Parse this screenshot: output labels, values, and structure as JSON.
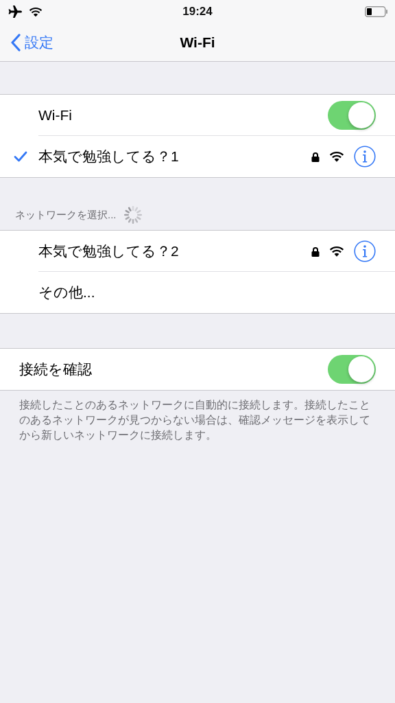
{
  "status_bar": {
    "time": "19:24"
  },
  "nav": {
    "back": "設定",
    "title": "Wi-Fi"
  },
  "groups": [
    {
      "rows": [
        {
          "kind": "toggle",
          "label": "Wi-Fi",
          "on": true,
          "indent": true
        },
        {
          "kind": "network",
          "label": "本気で勉強してる？1",
          "selected": true,
          "secured": true
        }
      ]
    },
    {
      "header": "ネットワークを選択...",
      "loading": true,
      "rows": [
        {
          "kind": "network",
          "label": "本気で勉強してる？2",
          "selected": false,
          "secured": true
        },
        {
          "kind": "other",
          "label": "その他..."
        }
      ]
    },
    {
      "rows": [
        {
          "kind": "toggle",
          "label": "接続を確認",
          "on": true,
          "indent": false
        }
      ],
      "footer": "接続したことのあるネットワークに自動的に接続します。接続したことのあるネットワークが見つからない場合は、確認メッセージを表示してから新しいネットワークに接続します。"
    }
  ]
}
